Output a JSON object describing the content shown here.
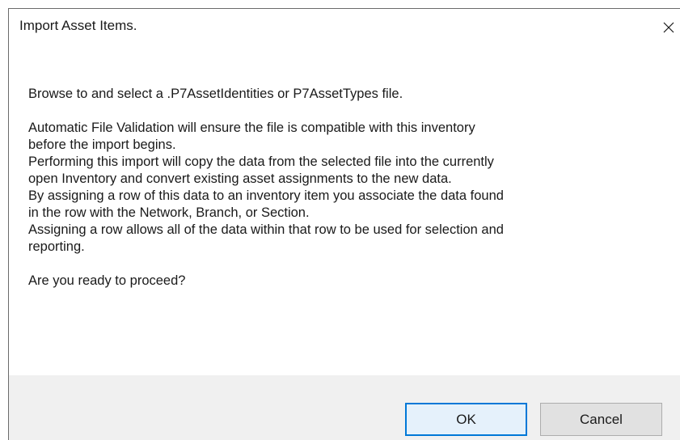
{
  "dialog": {
    "title": "Import Asset Items.",
    "close_icon": "close-icon",
    "message_lines": [
      "Browse to and select a .P7AssetIdentities or P7AssetTypes file.",
      "",
      "Automatic File Validation will ensure the file is compatible with this inventory",
      "before the import begins.",
      "Performing this import will copy the data from the selected file into the currently",
      "open Inventory and convert existing asset assignments to the new data.",
      "By assigning a row of this data to an inventory item you associate the data found",
      "in the row with the Network, Branch, or Section.",
      "Assigning a row allows all of the data within that row to be used for selection and",
      "reporting.",
      "",
      "Are you ready to proceed?"
    ],
    "buttons": {
      "ok_label": "OK",
      "cancel_label": "Cancel"
    },
    "colors": {
      "default_button_border": "#0078d7",
      "footer_background": "#f0f0f0"
    }
  }
}
